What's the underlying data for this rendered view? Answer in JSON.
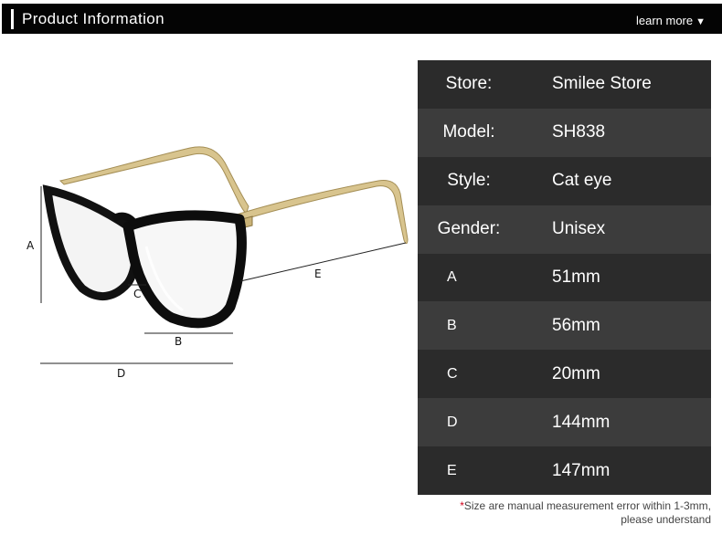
{
  "header": {
    "title": "Product Information",
    "learn_more": "learn more",
    "arrow": "▼"
  },
  "diagram": {
    "labels": {
      "a": "A",
      "b": "B",
      "c": "C",
      "d": "D",
      "e": "E"
    }
  },
  "specs": [
    {
      "key": "Store:",
      "value": "Smilee Store"
    },
    {
      "key": "Model:",
      "value": "SH838"
    },
    {
      "key": "Style:",
      "value": "Cat eye"
    },
    {
      "key": "Gender:",
      "value": "Unisex"
    },
    {
      "key": "A",
      "value": "51mm"
    },
    {
      "key": "B",
      "value": "56mm"
    },
    {
      "key": "C",
      "value": "20mm"
    },
    {
      "key": "D",
      "value": "144mm"
    },
    {
      "key": "E",
      "value": "147mm"
    }
  ],
  "note": {
    "star": "*",
    "line1": "Size are manual measurement error within 1-3mm,",
    "line2": "please understand"
  },
  "colors": {
    "header_bg": "#040404",
    "row_dark": "#2b2b2b",
    "row_light": "#3c3c3c",
    "frame": "#0d0d0d",
    "temple_gold": "#d8c48e",
    "note_star": "#d0021b"
  }
}
